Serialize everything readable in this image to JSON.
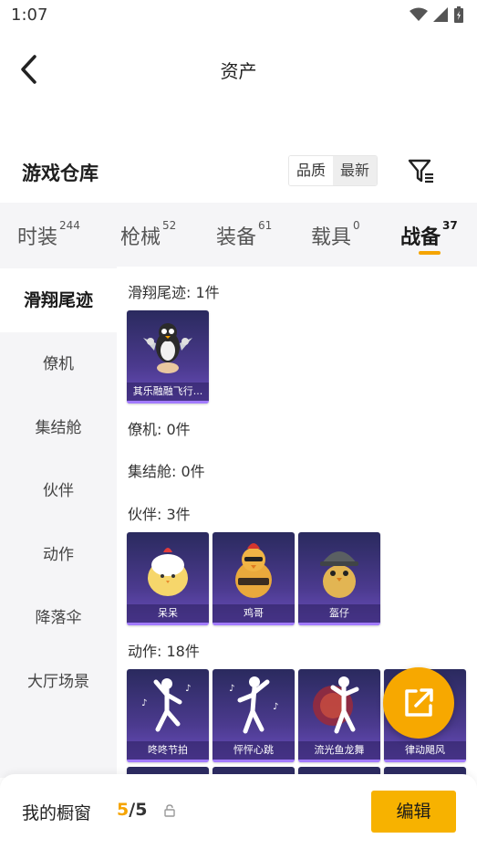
{
  "status_bar": {
    "time": "1:07"
  },
  "header": {
    "title": "资产",
    "back_icon": "chevron-left-icon"
  },
  "warehouse": {
    "title": "游戏仓库",
    "sort_options": [
      "品质",
      "最新"
    ],
    "filter_icon": "filter-icon"
  },
  "tabs": [
    {
      "label": "时装",
      "count": "244"
    },
    {
      "label": "枪械",
      "count": "52"
    },
    {
      "label": "装备",
      "count": "61"
    },
    {
      "label": "载具",
      "count": "0"
    },
    {
      "label": "战备",
      "count": "37",
      "active": true
    }
  ],
  "sidebar": {
    "items": [
      "滑翔尾迹",
      "僚机",
      "集结舱",
      "伙伴",
      "动作",
      "降落伞",
      "大厅场景"
    ]
  },
  "sections": [
    {
      "title": "滑翔尾迹: 1件",
      "items": [
        "其乐融融飞行..."
      ]
    },
    {
      "title": "僚机: 0件",
      "items": []
    },
    {
      "title": "集结舱: 0件",
      "items": []
    },
    {
      "title": "伙伴: 3件",
      "items": [
        "呆呆",
        "鸡哥",
        "盔仔"
      ]
    },
    {
      "title": "动作: 18件",
      "items": [
        "咚咚节拍",
        "怦怦心跳",
        "流光鱼龙舞",
        "律动飓风"
      ]
    }
  ],
  "fab": {
    "icon": "share-external-icon"
  },
  "bottom_bar": {
    "label": "我的橱窗",
    "current": "5",
    "separator": "/",
    "max": "5",
    "lock_icon": "lock-icon",
    "edit_label": "编辑"
  },
  "colors": {
    "accent": "#f5a400",
    "card_bg": "#4b3a8e",
    "sidebar_bg": "#f5f5f7"
  }
}
